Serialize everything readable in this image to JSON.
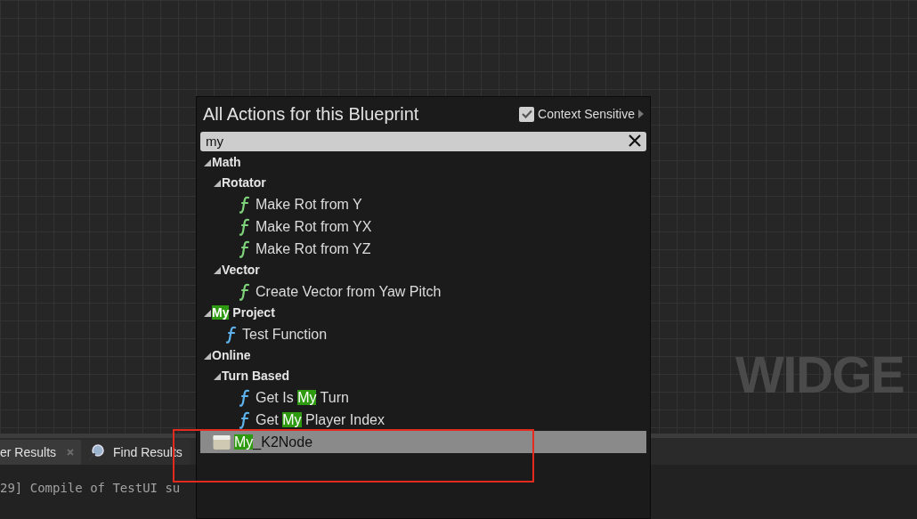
{
  "canvas": {
    "watermark": "WIDGE"
  },
  "bottom_panel": {
    "tabs": [
      {
        "label": "er Results",
        "closable": true,
        "selected": true
      },
      {
        "label": "Find Results",
        "closable": false,
        "selected": false
      }
    ],
    "log_line": "29] Compile of TestUI su"
  },
  "action_menu": {
    "title": "All Actions for this Blueprint",
    "context_sensitive": {
      "label": "Context Sensitive",
      "checked": true
    },
    "search": {
      "value": "my"
    },
    "tree": [
      {
        "kind": "category",
        "expanded": true,
        "parts": [
          {
            "text": "Math",
            "match": false
          }
        ],
        "children": [
          {
            "kind": "category",
            "expanded": true,
            "parts": [
              {
                "text": "Rotator",
                "match": false
              }
            ],
            "children": [
              {
                "kind": "function",
                "color": "#7fd37a",
                "selected": false,
                "parts": [
                  {
                    "text": "Make Rot from Y",
                    "match": false
                  }
                ]
              },
              {
                "kind": "function",
                "color": "#7fd37a",
                "selected": false,
                "parts": [
                  {
                    "text": "Make Rot from YX",
                    "match": false
                  }
                ]
              },
              {
                "kind": "function",
                "color": "#7fd37a",
                "selected": false,
                "parts": [
                  {
                    "text": "Make Rot from YZ",
                    "match": false
                  }
                ]
              }
            ]
          },
          {
            "kind": "category",
            "expanded": true,
            "parts": [
              {
                "text": "Vector",
                "match": false
              }
            ],
            "children": [
              {
                "kind": "function",
                "color": "#7fd37a",
                "selected": false,
                "parts": [
                  {
                    "text": "Create Vector from Yaw Pitch",
                    "match": false
                  }
                ]
              }
            ]
          }
        ]
      },
      {
        "kind": "category",
        "expanded": true,
        "parts": [
          {
            "text": "My",
            "match": true
          },
          {
            "text": " Project",
            "match": false
          }
        ],
        "children": [
          {
            "kind": "function",
            "color": "#5eb3ec",
            "selected": false,
            "parts": [
              {
                "text": "Test Function",
                "match": false
              }
            ]
          }
        ]
      },
      {
        "kind": "category",
        "expanded": true,
        "parts": [
          {
            "text": "Online",
            "match": false
          }
        ],
        "children": [
          {
            "kind": "category",
            "expanded": true,
            "parts": [
              {
                "text": "Turn Based",
                "match": false
              }
            ],
            "children": [
              {
                "kind": "function",
                "color": "#5eb3ec",
                "selected": false,
                "parts": [
                  {
                    "text": "Get Is ",
                    "match": false
                  },
                  {
                    "text": "My",
                    "match": true
                  },
                  {
                    "text": " Turn",
                    "match": false
                  }
                ]
              },
              {
                "kind": "function",
                "color": "#5eb3ec",
                "selected": false,
                "parts": [
                  {
                    "text": "Get ",
                    "match": false
                  },
                  {
                    "text": "My",
                    "match": true
                  },
                  {
                    "text": " Player Index",
                    "match": false
                  }
                ]
              }
            ]
          }
        ]
      },
      {
        "kind": "struct",
        "selected": true,
        "parts": [
          {
            "text": "My",
            "match": true
          },
          {
            "text": "_K2Node",
            "match": false
          }
        ]
      }
    ]
  }
}
